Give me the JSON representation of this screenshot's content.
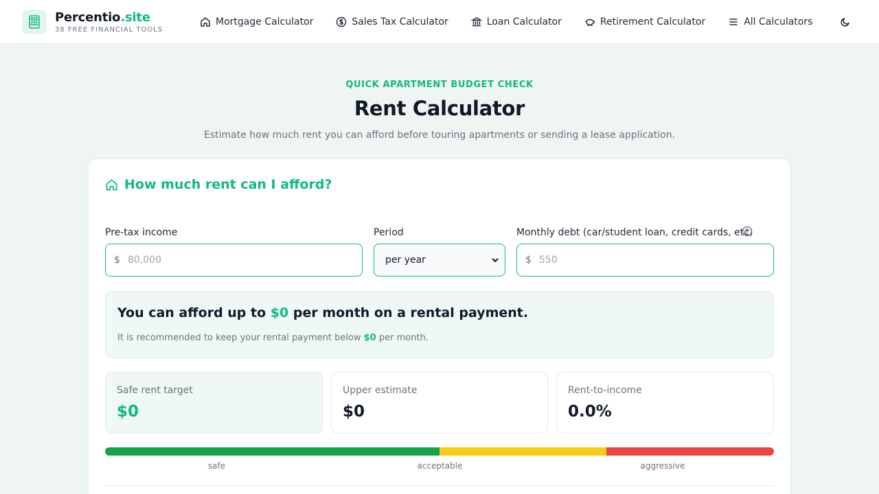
{
  "brand": {
    "name_main": "Percentio",
    "name_accent": ".site",
    "tagline": "38 FREE FINANCIAL TOOLS",
    "icon": "calculator-icon",
    "accent_color": "#10b981"
  },
  "nav": {
    "items": [
      {
        "label": "Mortgage Calculator",
        "icon": "home-icon"
      },
      {
        "label": "Sales Tax Calculator",
        "icon": "dollar-circle-icon"
      },
      {
        "label": "Loan Calculator",
        "icon": "bank-icon"
      },
      {
        "label": "Retirement Calculator",
        "icon": "piggy-bank-icon"
      },
      {
        "label": "All Calculators",
        "icon": "menu-icon"
      }
    ],
    "theme_toggle_icon": "moon-icon"
  },
  "hero": {
    "eyebrow": "QUICK APARTMENT BUDGET CHECK",
    "title": "Rent Calculator",
    "subtitle": "Estimate how much rent you can afford before touring apartments or sending a lease application."
  },
  "calculator": {
    "heading": "How much rent can I afford?",
    "heading_icon": "home-icon",
    "fields": {
      "income": {
        "label": "Pre-tax income",
        "prefix": "$",
        "value": "",
        "placeholder": "80,000"
      },
      "period": {
        "label": "Period",
        "selected": "per year"
      },
      "debt": {
        "label": "Monthly debt (car/student loan, credit cards, etc)",
        "prefix": "$",
        "value": "",
        "placeholder": "550",
        "help_icon": "question-circle-icon"
      }
    },
    "result": {
      "main_prefix": "You can afford up to ",
      "main_amount": "$0",
      "main_suffix": " per month on a rental payment.",
      "sub_prefix": "It is recommended to keep your rental payment below ",
      "sub_amount": "$0",
      "sub_suffix": " per month."
    },
    "stats": [
      {
        "label": "Safe rent target",
        "value": "$0"
      },
      {
        "label": "Upper estimate",
        "value": "$0"
      },
      {
        "label": "Rent-to-income",
        "value": "0.0%"
      }
    ],
    "meter": {
      "labels": [
        "safe",
        "acceptable",
        "aggressive"
      ],
      "colors": [
        "#16a34a",
        "#facc15",
        "#ef4444"
      ],
      "shares": [
        0.5,
        0.25,
        0.25
      ]
    }
  }
}
